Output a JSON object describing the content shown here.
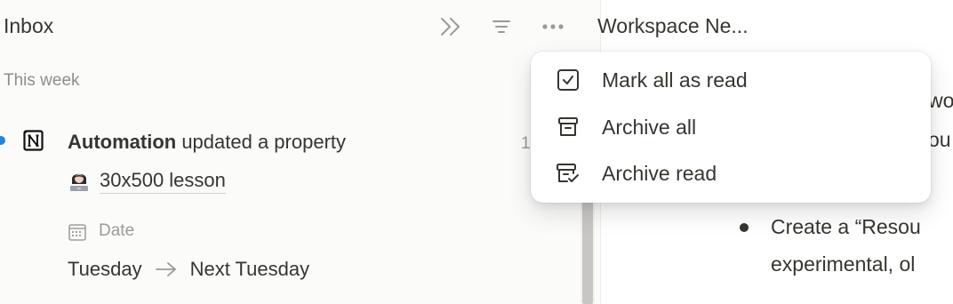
{
  "inbox": {
    "title": "Inbox",
    "section": "This week",
    "header_buttons": [
      "double-chevron-right-icon",
      "filter-icon",
      "more-horizontal-icon"
    ],
    "notification": {
      "unread": true,
      "actor": "Automation",
      "action": " updated a property",
      "time": "1",
      "page_emoji": "person-at-laptop-emoji",
      "page_title": "30x500 lesson",
      "property_label": "Date",
      "old_value": "Tuesday",
      "new_value": "Next Tuesday"
    }
  },
  "document": {
    "title": "Workspace Ne...",
    "fragment_1": "wor",
    "fragment_2": "ou",
    "bullet_text_1": "Create a “Resou",
    "bullet_text_2": "experimental, ol"
  },
  "menu": {
    "items": [
      {
        "label": "Mark all as read",
        "icon": "checkbox-icon"
      },
      {
        "label": "Archive all",
        "icon": "archive-box-icon"
      },
      {
        "label": "Archive read",
        "icon": "archive-check-icon"
      }
    ]
  },
  "colors": {
    "unread_dot": "#2383e2",
    "text": "#37352f",
    "muted": "#9b9a97",
    "panel_bg": "#fbfbfa"
  }
}
